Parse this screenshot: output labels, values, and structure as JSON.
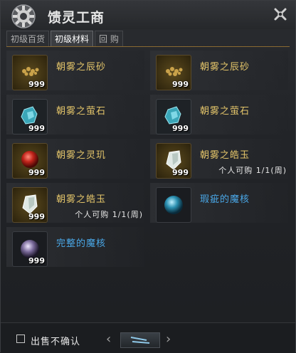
{
  "header": {
    "title": "馈灵工商"
  },
  "tabs": [
    {
      "label": "初级百货",
      "active": false
    },
    {
      "label": "初级材料",
      "active": true
    },
    {
      "label": "回 购",
      "active": false
    }
  ],
  "items": [
    {
      "name": "朝雾之辰砂",
      "qty": "999",
      "limit": "",
      "icon": "cinnabar-icon",
      "color": "gold"
    },
    {
      "name": "朝雾之辰砂",
      "qty": "999",
      "limit": "",
      "icon": "cinnabar-icon",
      "color": "gold"
    },
    {
      "name": "朝雾之萤石",
      "qty": "999",
      "limit": "",
      "icon": "fluorite-icon",
      "color": "gold"
    },
    {
      "name": "朝雾之萤石",
      "qty": "999",
      "limit": "",
      "icon": "fluorite-icon",
      "color": "gold"
    },
    {
      "name": "朝雾之灵玑",
      "qty": "999",
      "limit": "",
      "icon": "spirit-pearl-icon",
      "color": "gold"
    },
    {
      "name": "朝雾之皓玉",
      "qty": "999",
      "limit": "个人可购 1/1(周)",
      "icon": "white-jade-icon",
      "color": "gold"
    },
    {
      "name": "朝雾之皓玉",
      "qty": "999",
      "limit": "个人可购 1/1(周)",
      "icon": "white-jade-icon",
      "color": "gold"
    },
    {
      "name": "瑕疵的魔核",
      "qty": "",
      "limit": "",
      "icon": "flawed-core-icon",
      "color": "blue"
    },
    {
      "name": "完整的魔核",
      "qty": "999",
      "limit": "",
      "icon": "complete-core-icon",
      "color": "blue"
    }
  ],
  "footer": {
    "checkbox_label": "出售不确认",
    "prev": "‹",
    "next": "›"
  },
  "colors": {
    "gold_text": "#e4c56a",
    "blue_text": "#4aa8e8",
    "divider": "#8a6a32"
  }
}
